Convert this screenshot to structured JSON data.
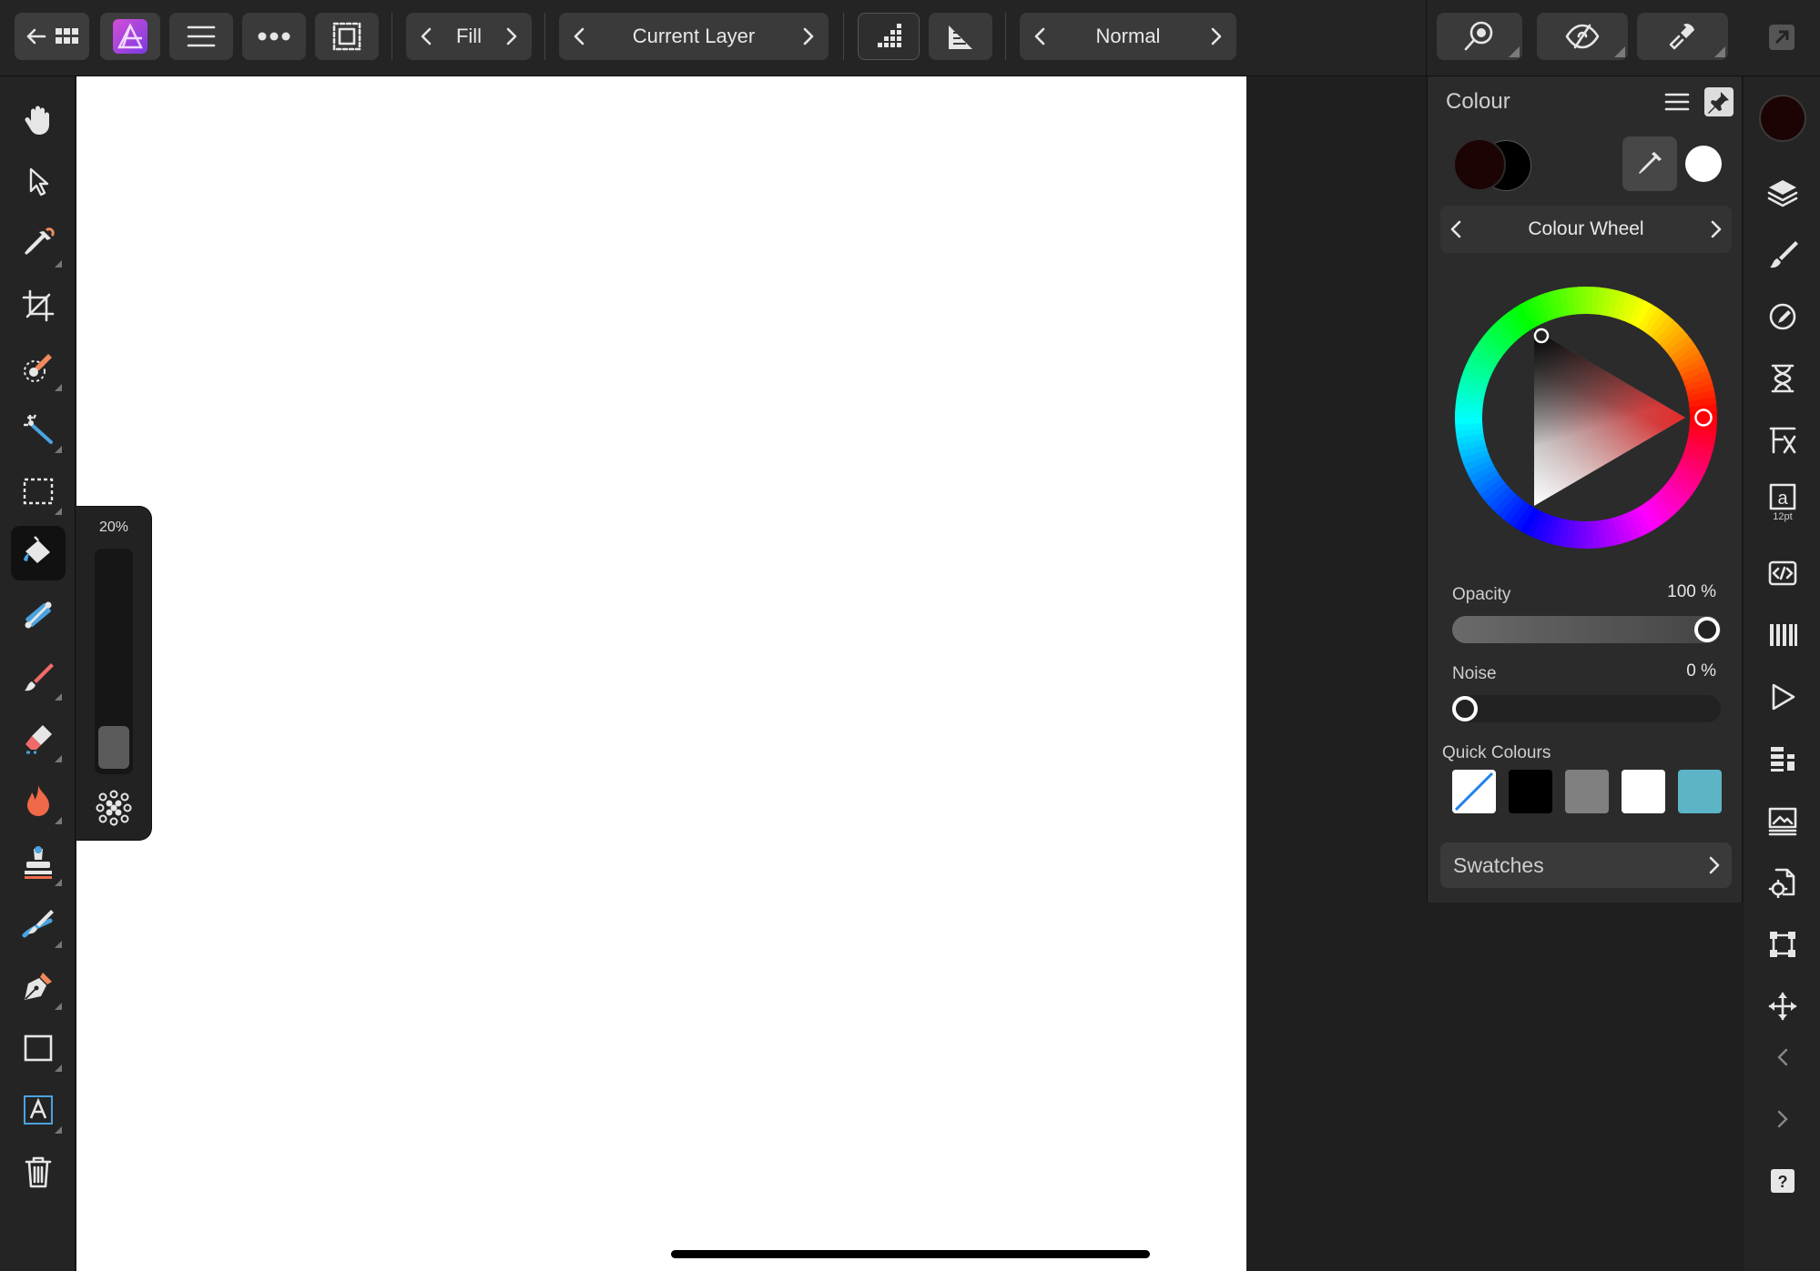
{
  "topbar": {
    "fill_label": "Fill",
    "layer_label": "Current Layer",
    "blend_label": "Normal"
  },
  "brush_popup": {
    "size_percent_label": "20%",
    "size_value_fraction": 0.2
  },
  "color_panel": {
    "title": "Colour",
    "mode_label": "Colour Wheel",
    "opacity_label": "Opacity",
    "opacity_value": "100 %",
    "noise_label": "Noise",
    "noise_value": "0 %",
    "quick_colours_label": "Quick Colours",
    "quick_colours": [
      "none",
      "#000000",
      "#808080",
      "#ffffff",
      "#5bb5c6"
    ],
    "swatches_label": "Swatches",
    "primary_color": "#1c0404",
    "secondary_color": "#000000",
    "selected_hue_color": "#e8292a"
  },
  "studio": {
    "text_size_label": "12pt"
  }
}
